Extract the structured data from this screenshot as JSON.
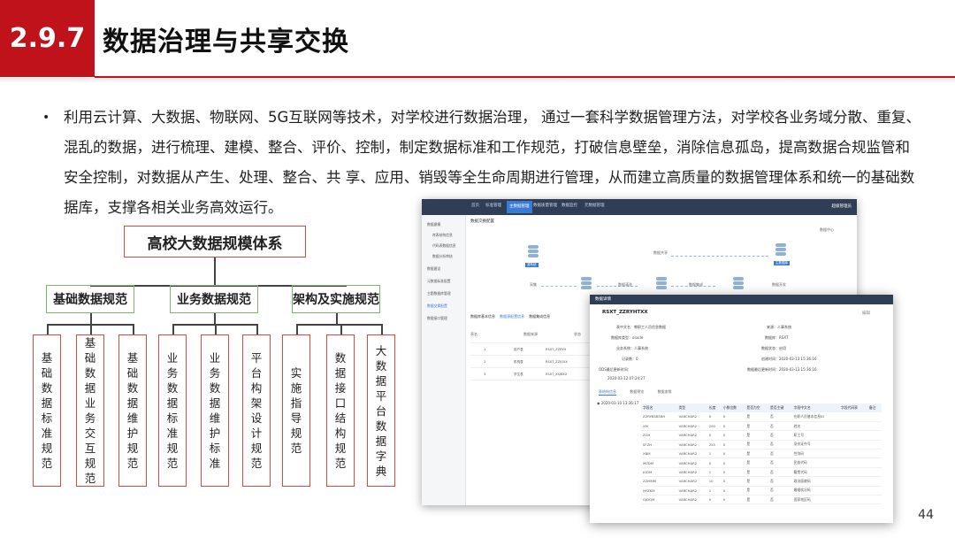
{
  "header": {
    "section_number": "2.9.7",
    "title": "数据治理与共享交换"
  },
  "paragraph": "利用云计算、大数据、物联网、5G互联网等技术，对学校进行数据治理， 通过一套科学数据管理方法，对学校各业务域分散、重复、混乱的数据，进行梳理、建模、整合、评价、控制，制定数据标准和工作规范，打破信息壁垒，消除信息孤岛，提高数据合规监管和安全控制，对数据从产生、处理、整合、共 享、应用、销毁等全生命周期进行管理，从而建立高质量的数据管理体系和统一的基础数据库，支撑各相关业务高效运行。",
  "org_chart": {
    "root": "高校大数据规模体系",
    "groups": [
      "基础数据规范",
      "业务数据规范",
      "架构及实施规范"
    ],
    "leaves": [
      "基础数据标准规范",
      "基础数据业务交互规范",
      "基础数据维护规范",
      "业务数据标准规范",
      "业务数据维护标准",
      "平台构架设计规范",
      "实施指导规范",
      "数据接口结构规范",
      "大数据平台数据字典"
    ]
  },
  "screenshot_main": {
    "nav_tabs": [
      "首页",
      "标准管理",
      "主数据管理",
      "数据质量管理",
      "数据监控",
      "元数据管理"
    ],
    "active_tab": "主数据管理",
    "user": "超级管理员",
    "sidebar": [
      "数据建模",
      "库表结构信息",
      "代码表数据信息",
      "数据分析审核",
      "数据建设",
      "元数据标准配置",
      "主题数据库管理",
      "数据交换配置",
      "数据接口管理"
    ],
    "breadcrumb": "数据交换配置",
    "right_link": "数据中心",
    "flow_labels": [
      "源系统",
      "采集",
      "数据清洗",
      "数据集成",
      "数据共享",
      "数据开发",
      "主数据库"
    ],
    "lower_tabs": [
      "数据库基本信息",
      "数据源配置信息",
      "数据集成信息"
    ],
    "filter_labels": [
      "表名",
      "数据来源",
      "状态"
    ],
    "table_rows": [
      [
        "1",
        "用户表",
        "RSXT_ZZRYH",
        "已启用"
      ],
      [
        "2",
        "机构表",
        "RSXT_ZZJGXX",
        "已启用"
      ],
      [
        "3",
        "学生表",
        "RSXT_XSJBXX",
        "已启用"
      ]
    ]
  },
  "screenshot_detail": {
    "dialog_title": "数据详情",
    "table_name": "RSXT_ZZRYHTXX",
    "edit_label": "编辑",
    "fields_left": [
      [
        "表中文名",
        "教职工人员信息数据"
      ],
      [
        "数据库类型",
        "oracle"
      ],
      [
        "业务系统",
        "人事系统"
      ],
      [
        "记录数",
        "0"
      ],
      [
        "ODS最后更新时间",
        "2020-03-12 07:24:27"
      ]
    ],
    "fields_right": [
      [
        "来源",
        "人事系统"
      ],
      [
        "数据库",
        "RSXT"
      ],
      [
        "数据状态",
        "启用"
      ],
      [
        "创建时间",
        "2020-03-13 15:36:16"
      ],
      [
        "数据最后更新时间",
        "2020-03-13 15:36:16"
      ]
    ],
    "tabs": [
      "表结构信息",
      "数据预览",
      "数据血缘"
    ],
    "side_time": "2020-03-10 13:36:17",
    "columns": [
      "字段名",
      "类型",
      "长度",
      "小数位数",
      "是否为空",
      "是否主键",
      "字段中文名",
      "字段代码表",
      "备注"
    ],
    "rows": [
      [
        "ZZRYBSBSBH",
        "VARCHAR2",
        "0",
        "0",
        "是",
        "否",
        "在职人员基本信息ID",
        "",
        ""
      ],
      [
        "XM",
        "VARCHAR2",
        "200",
        "0",
        "是",
        "否",
        "姓名",
        "",
        ""
      ],
      [
        "ZGH",
        "VARCHAR2",
        "0",
        "0",
        "是",
        "否",
        "职工号",
        "",
        ""
      ],
      [
        "SFZH",
        "VARCHAR2",
        "255",
        "0",
        "是",
        "否",
        "身份证件号",
        "",
        ""
      ],
      [
        "XBM",
        "VARCHAR2",
        "1",
        "0",
        "是",
        "否",
        "性别码",
        "",
        ""
      ],
      [
        "MZDM",
        "VARCHAR2",
        "0",
        "0",
        "是",
        "否",
        "民族代码",
        "",
        ""
      ],
      [
        "JGDM",
        "VARCHAR2",
        "1",
        "0",
        "是",
        "否",
        "籍贯代码",
        "",
        ""
      ],
      [
        "ZZMMM",
        "VARCHAR2",
        "10",
        "0",
        "是",
        "否",
        "政治面貌码",
        "",
        ""
      ],
      [
        "HYZKM",
        "VARCHAR2",
        "1",
        "0",
        "是",
        "否",
        "婚姻状况码",
        "",
        ""
      ],
      [
        "GJDQM",
        "VARCHAR2",
        "0",
        "0",
        "是",
        "否",
        "国家地区码",
        "",
        ""
      ]
    ]
  },
  "page_number": "44"
}
